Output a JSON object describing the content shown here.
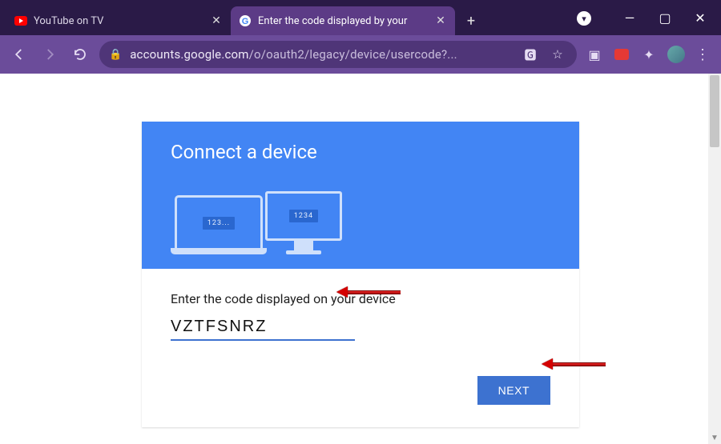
{
  "window": {
    "minimize_glyph": "—",
    "maximize_glyph": "▢",
    "close_glyph": "✕",
    "dropdown_glyph": "▾"
  },
  "tabs": [
    {
      "title": "YouTube on TV",
      "active": false,
      "favicon": "youtube",
      "close_glyph": "✕"
    },
    {
      "title": "Enter the code displayed by your",
      "active": true,
      "favicon": "google",
      "close_glyph": "✕"
    }
  ],
  "newtab_glyph": "+",
  "toolbar": {
    "url_host": "accounts.google.com",
    "url_path": "/o/oauth2/legacy/device/usercode?...",
    "lock_glyph": "🔒",
    "translate_glyph": "🅶",
    "star_glyph": "☆",
    "panel_glyph": "▣",
    "ext_glyph": "✦",
    "menu_glyph": "⋮"
  },
  "page": {
    "hero_title": "Connect a device",
    "laptop_code": "123...",
    "monitor_code": "1234",
    "field_label": "Enter the code displayed on your device",
    "code_value": "VZTFSNRZ",
    "next_label": "NEXT"
  }
}
